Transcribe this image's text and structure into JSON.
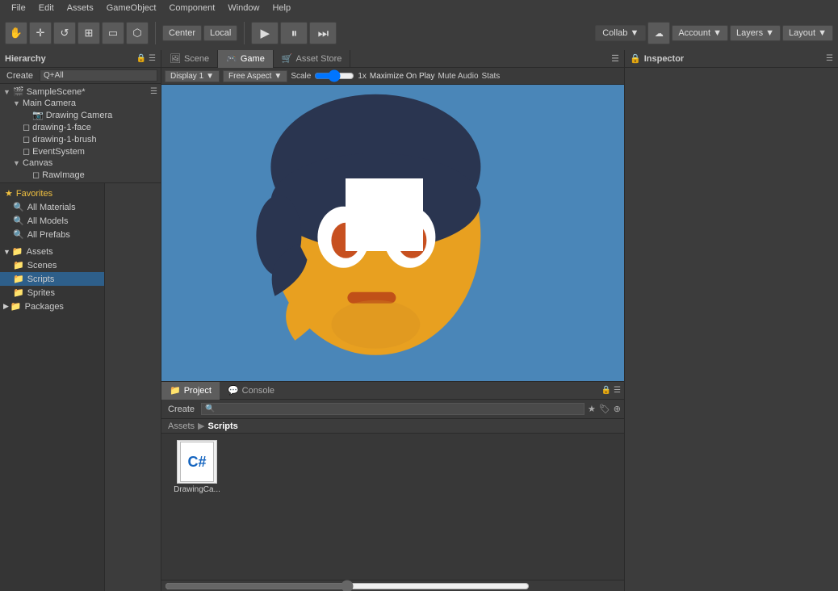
{
  "menubar": {
    "items": [
      "File",
      "Edit",
      "Assets",
      "GameObject",
      "Component",
      "Window",
      "Help"
    ]
  },
  "toolbar": {
    "transform_tools": [
      "⊕",
      "↔",
      "↻",
      "⬜",
      "⬡",
      "⟳"
    ],
    "pivot_btn": "Center",
    "local_btn": "Local",
    "play_btn": "▶",
    "pause_btn": "⏸",
    "step_btn": "⏭",
    "collab_label": "Collab ▼",
    "cloud_icon": "☁",
    "account_label": "Account ▼",
    "layers_label": "Layers ▼",
    "layout_label": "Layout ▼"
  },
  "hierarchy": {
    "title": "Hierarchy",
    "create_label": "Create",
    "search_placeholder": "Q+All",
    "items": [
      {
        "label": "SampleScene*",
        "level": 0,
        "arrow": "▼",
        "icon": "🎬"
      },
      {
        "label": "Main Camera",
        "level": 1,
        "arrow": "▼",
        "icon": ""
      },
      {
        "label": "Drawing Camera",
        "level": 2,
        "arrow": "",
        "icon": "📷"
      },
      {
        "label": "drawing-1-face",
        "level": 1,
        "arrow": "",
        "icon": "◻"
      },
      {
        "label": "drawing-1-brush",
        "level": 1,
        "arrow": "",
        "icon": "◻"
      },
      {
        "label": "EventSystem",
        "level": 1,
        "arrow": "",
        "icon": "◻"
      },
      {
        "label": "Canvas",
        "level": 1,
        "arrow": "▼",
        "icon": ""
      },
      {
        "label": "RawImage",
        "level": 2,
        "arrow": "",
        "icon": "◻"
      }
    ]
  },
  "tabs": {
    "scene": "Scene",
    "game": "Game",
    "asset_store": "Asset Store"
  },
  "game_toolbar": {
    "display_label": "Display 1",
    "aspect_label": "Free Aspect",
    "scale_label": "Scale",
    "scale_value": "1x",
    "maximize_label": "Maximize On Play",
    "mute_label": "Mute Audio",
    "stats_label": "Stats"
  },
  "inspector": {
    "title": "Inspector"
  },
  "bottom": {
    "project_tab": "Project",
    "console_tab": "Console",
    "create_label": "Create",
    "search_placeholder": ""
  },
  "project_sidebar": {
    "favorites_label": "Favorites",
    "all_materials": "All Materials",
    "all_models": "All Models",
    "all_prefabs": "All Prefabs",
    "assets_label": "Assets",
    "scenes": "Scenes",
    "scripts": "Scripts",
    "sprites": "Sprites",
    "packages": "Packages"
  },
  "breadcrumb": {
    "items": [
      "Assets",
      "Scripts"
    ]
  },
  "files": [
    {
      "name": "DrawingCa...",
      "type": "cs"
    }
  ],
  "colors": {
    "bg_dark": "#3c3c3c",
    "bg_darker": "#2a2a2a",
    "bg_viewport": "#4a86b8",
    "selected_blue": "#2e5f8a",
    "accent_gold": "#f0c040"
  }
}
